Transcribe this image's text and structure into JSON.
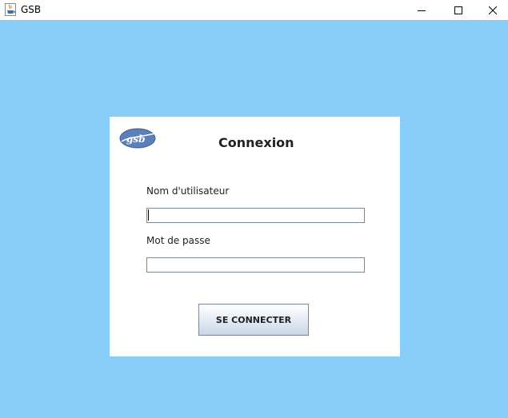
{
  "window": {
    "title": "GSB",
    "app_icon": "java-cup-icon",
    "controls": {
      "minimize_icon": "minimize-icon",
      "maximize_icon": "maximize-icon",
      "close_icon": "close-icon"
    }
  },
  "colors": {
    "background": "#87cefa",
    "panel": "#ffffff",
    "logo": "#5b7fb8"
  },
  "login": {
    "logo_text": "gsb",
    "title": "Connexion",
    "username_label": "Nom d'utilisateur",
    "username_value": "",
    "password_label": "Mot de passe",
    "password_value": "",
    "submit_label": "SE CONNECTER"
  }
}
